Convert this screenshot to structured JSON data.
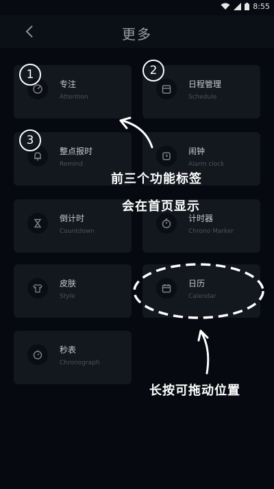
{
  "status": {
    "time": "8:55"
  },
  "header": {
    "title": "更多"
  },
  "features": [
    {
      "zh": "专注",
      "en": "Attention",
      "icon": "focus-icon"
    },
    {
      "zh": "日程管理",
      "en": "Schedule",
      "icon": "calendar-icon"
    },
    {
      "zh": "整点报时",
      "en": "Remind",
      "icon": "bell-icon"
    },
    {
      "zh": "闹钟",
      "en": "Alarm clock",
      "icon": "alarm-icon"
    },
    {
      "zh": "倒计时",
      "en": "Countdown",
      "icon": "hourglass-icon"
    },
    {
      "zh": "计时器",
      "en": "Chrono Marker",
      "icon": "stopwatch-icon"
    },
    {
      "zh": "皮肤",
      "en": "Style",
      "icon": "shirt-icon"
    },
    {
      "zh": "日历",
      "en": "Calendar",
      "icon": "calendar-icon"
    },
    {
      "zh": "秒表",
      "en": "Chronograph",
      "icon": "timer-icon"
    }
  ],
  "badges": [
    "1",
    "2",
    "3"
  ],
  "annotations": {
    "line1": "前三个功能标签",
    "line2": "会在首页显示",
    "line3": "长按可拖动位置"
  }
}
